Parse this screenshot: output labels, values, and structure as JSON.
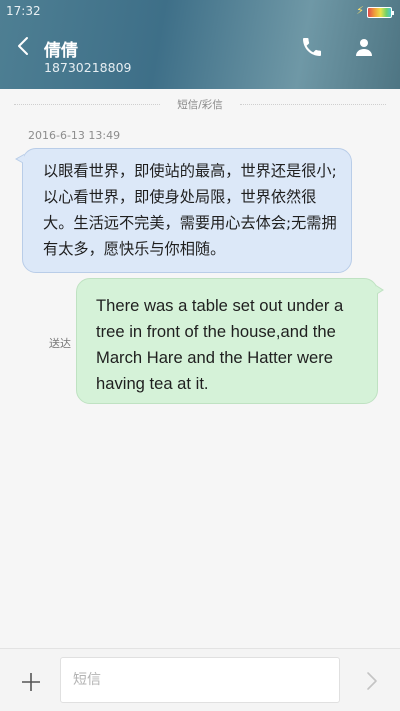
{
  "status_bar": {
    "time": "17:32",
    "charging_icon": "lightning-icon",
    "battery_icon": "battery-icon"
  },
  "header": {
    "back_icon": "chevron-left-icon",
    "contact_name": "倩倩",
    "contact_number": "18730218809",
    "call_icon": "phone-icon",
    "contact_icon": "person-icon",
    "accent_color": "#3e6f88"
  },
  "conversation": {
    "divider_label": "短信/彩信",
    "timestamp": "2016-6-13 13:49",
    "incoming": {
      "text": "以眼看世界，即使站的最高，世界还是很小;以心看世界，即使身处局限，世界依然很大。生活远不完美，需要用心去体会;无需拥有太多，愿快乐与你相随。",
      "bubble_color": "#dce8f8"
    },
    "outgoing": {
      "status": "送达",
      "text": "There was a table set out under a tree in front of the house,and the March Hare and the Hatter were having tea at it.",
      "bubble_color": "#d5f2d8"
    }
  },
  "compose": {
    "add_icon": "plus-icon",
    "placeholder": "短信",
    "value": "",
    "send_icon": "send-chevron-icon"
  }
}
